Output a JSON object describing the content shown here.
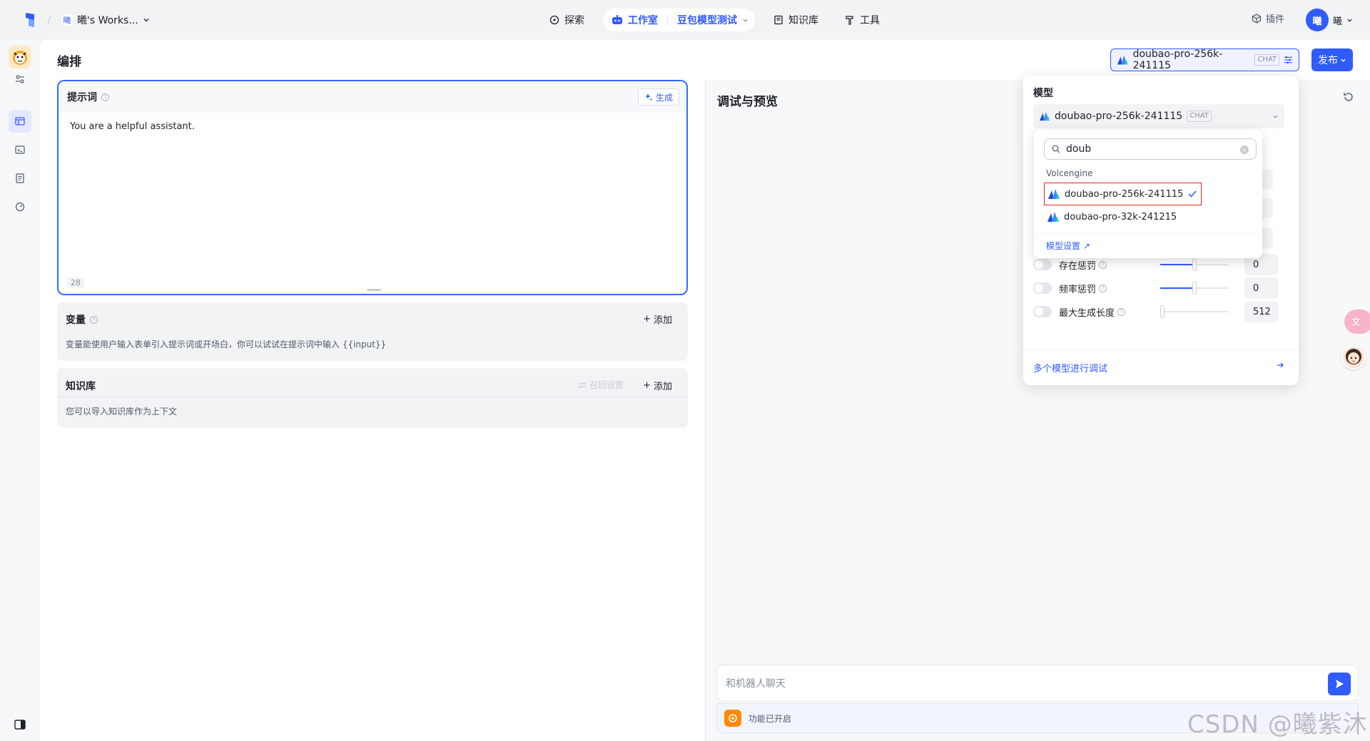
{
  "topbar": {
    "workspace": {
      "avatar": "曦",
      "name": "曦's Works..."
    },
    "nav": {
      "explore": "探索",
      "studio": "工作室",
      "project": "豆包模型测试",
      "knowledge": "知识库",
      "tools": "工具"
    },
    "plugin": "插件",
    "user": {
      "avatar": "曦",
      "name": "曦"
    }
  },
  "main": {
    "title": "编排"
  },
  "model_button": {
    "name": "doubao-pro-256k-241115",
    "tag": "CHAT"
  },
  "publish": "发布",
  "prompt": {
    "title": "提示词",
    "generate": "生成",
    "content": "You are a helpful assistant.",
    "count": "28"
  },
  "variables": {
    "title": "变量",
    "add": "添加",
    "desc": "变量能使用户输入表单引入提示词或开场白，你可以试试在提示词中输入 {{input}}"
  },
  "knowledge": {
    "title": "知识库",
    "recall": "召回设置",
    "add": "添加",
    "desc": "您可以导入知识库作为上下文"
  },
  "debug": {
    "title": "调试与预览",
    "chat_placeholder": "和机器人聊天",
    "function_status": "功能已开启"
  },
  "model_panel": {
    "label": "模型",
    "selected": {
      "name": "doubao-pro-256k-241115",
      "tag": "CHAT"
    },
    "params": [
      {
        "label": "存在惩罚",
        "value": "0",
        "level": 0.5
      },
      {
        "label": "频率惩罚",
        "value": "0",
        "level": 0.5
      },
      {
        "label": "最大生成长度",
        "value": "512",
        "level": 0.03
      }
    ],
    "multi_model": "多个模型进行调试"
  },
  "dropdown": {
    "search": "doub",
    "group": "Volcengine",
    "options": [
      {
        "name": "doubao-pro-256k-241115",
        "selected": true
      },
      {
        "name": "doubao-pro-32k-241215",
        "selected": false
      }
    ],
    "settings_link": "模型设置"
  },
  "watermark": "CSDN @曦紫沐",
  "colors": {
    "accent": "#2f5bff",
    "highlight": "#e02424"
  }
}
